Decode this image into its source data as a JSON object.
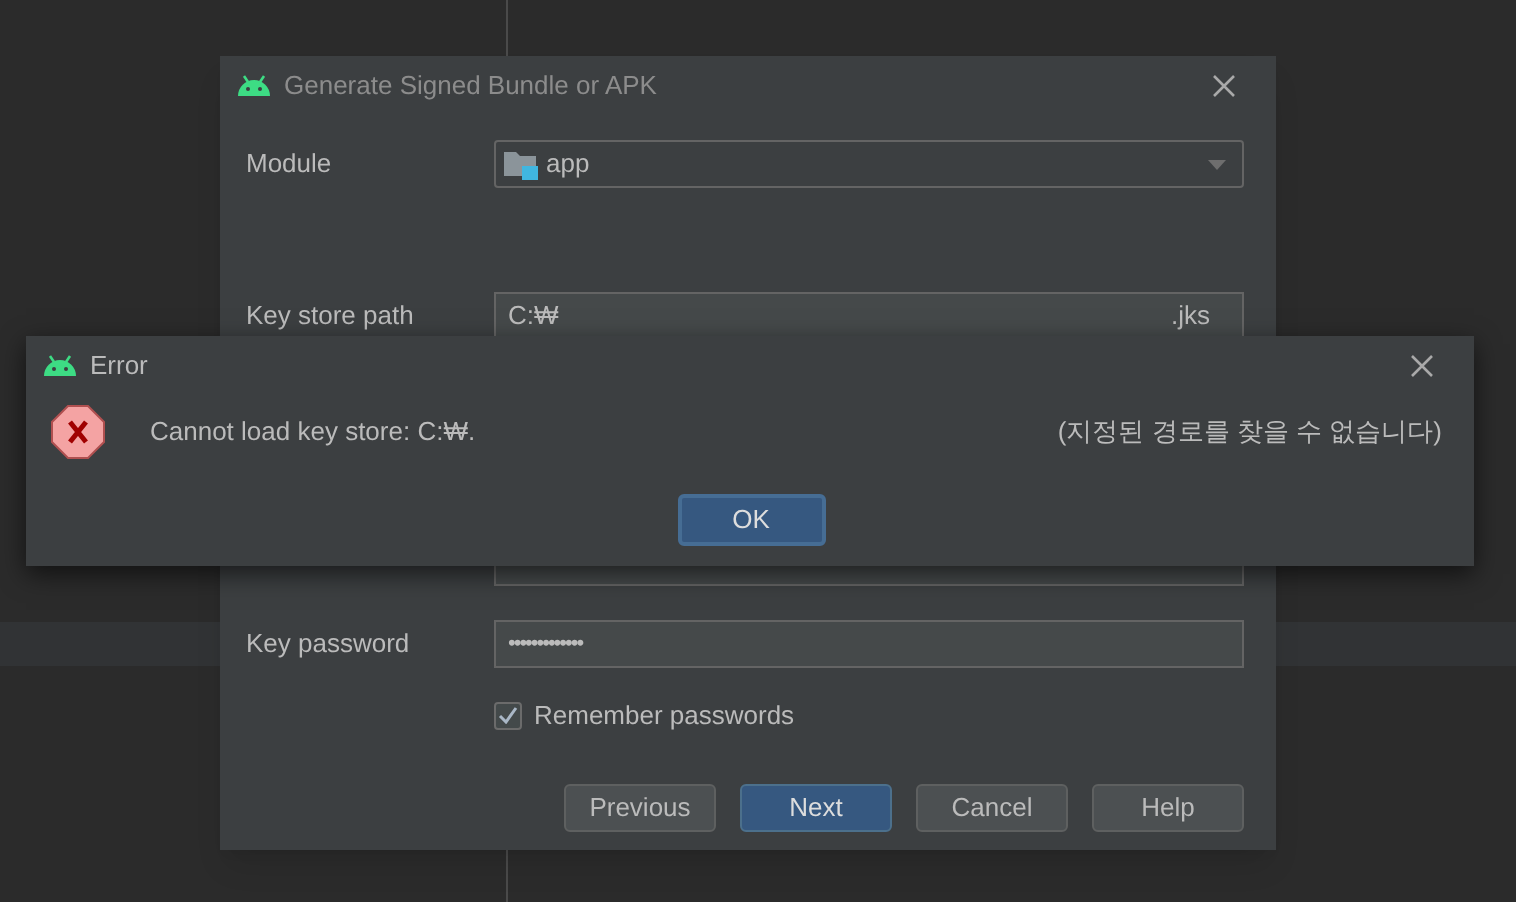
{
  "main_dialog": {
    "title": "Generate Signed Bundle or APK",
    "module": {
      "label": "Module",
      "value": "app"
    },
    "key_store_path": {
      "label": "Key store path",
      "value": "C:₩",
      "suffix": ".jks"
    },
    "key_password": {
      "label": "Key password",
      "value": "•••••••••••••"
    },
    "remember": {
      "label": "Remember passwords",
      "checked": true
    },
    "buttons": [
      {
        "label": "Previous",
        "primary": false
      },
      {
        "label": "Next",
        "primary": true
      },
      {
        "label": "Cancel",
        "primary": false
      },
      {
        "label": "Help",
        "primary": false
      }
    ]
  },
  "error_dialog": {
    "title": "Error",
    "message": "Cannot load key store: C:₩.",
    "detail": "(지정된 경로를 찾을 수 없습니다)",
    "button": "OK"
  }
}
